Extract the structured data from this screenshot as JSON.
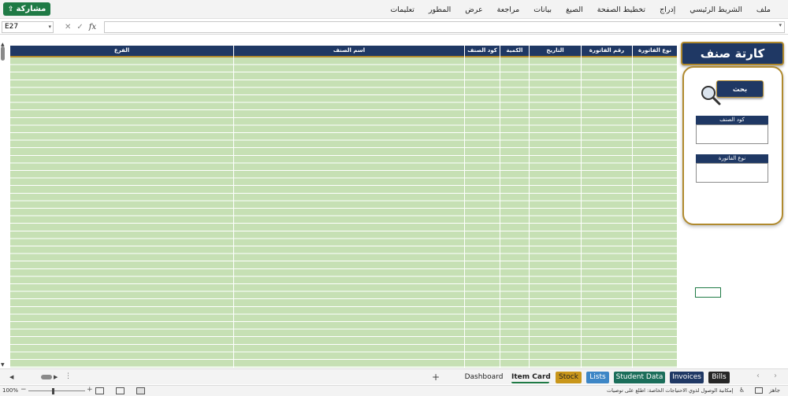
{
  "ribbon": {
    "share_label": "مشاركة",
    "menu": [
      "ملف",
      "الشريط الرئيسي",
      "إدراج",
      "تخطيط الصفحة",
      "الصيغ",
      "بيانات",
      "مراجعة",
      "عرض",
      "المطور",
      "تعليمات"
    ]
  },
  "formula_bar": {
    "name_box": "E27",
    "fx_label": "fx",
    "formula_value": ""
  },
  "table": {
    "columns": [
      "نوع الفاتورة",
      "رقم الفاتورة",
      "التاريخ",
      "الكمية",
      "كود الصنف",
      "اسم الصنف",
      "الفرع"
    ]
  },
  "card": {
    "title": "كارتة صنف",
    "search_label": "بحث",
    "field1_label": "كود الصنف",
    "field2_label": "نوع الفاتورة"
  },
  "tabs": [
    {
      "label": "Dashboard",
      "bg": "transparent",
      "fg": "#222222"
    },
    {
      "label": "Item Card",
      "bg": "transparent",
      "fg": "#222222",
      "active": true
    },
    {
      "label": "Stock",
      "bg": "#c9961a",
      "fg": "#222222"
    },
    {
      "label": "Lists",
      "bg": "#3d86c6",
      "fg": "#ffffff"
    },
    {
      "label": "Student Data",
      "bg": "#1b6e5a",
      "fg": "#ffffff"
    },
    {
      "label": "Invoices",
      "bg": "#1f3864",
      "fg": "#ffffff"
    },
    {
      "label": "Bills",
      "bg": "#262626",
      "fg": "#ffffff"
    }
  ],
  "status": {
    "zoom": "100%",
    "accessibility": "إمكانية الوصول لذوي الاحتياجات الخاصة: اطلع على توصيات",
    "ready": "جاهز"
  },
  "colors": {
    "header_navy": "#1f3864",
    "accent_gold": "#b08a2e",
    "grid_green": "#c6e0b4",
    "share_green": "#1f7a45"
  }
}
